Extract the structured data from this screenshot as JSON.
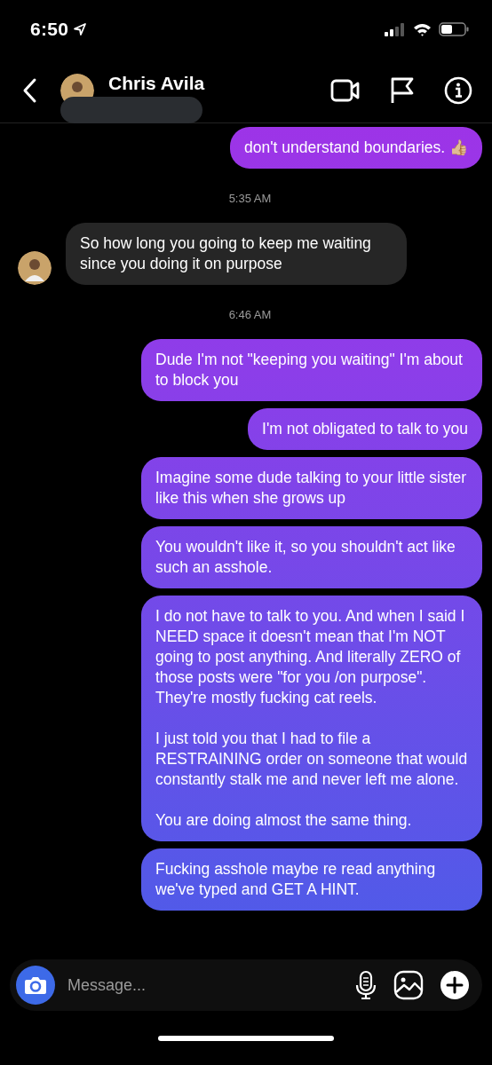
{
  "status_bar": {
    "time": "6:50"
  },
  "header": {
    "name": "Chris Avila"
  },
  "messages": [
    {
      "kind": "outgoing",
      "paragraphs": [
        "don't understand boundaries."
      ],
      "emoji": "👍🏼"
    },
    {
      "kind": "timestamp",
      "text": "5:35 AM"
    },
    {
      "kind": "incoming",
      "paragraphs": [
        "So how long you going to keep me waiting since you doing it on purpose"
      ]
    },
    {
      "kind": "timestamp",
      "text": "6:46 AM"
    },
    {
      "kind": "outgoing",
      "paragraphs": [
        "Dude I'm not \"keeping you waiting\" I'm about to block you"
      ]
    },
    {
      "kind": "outgoing",
      "paragraphs": [
        "I'm not obligated to talk to you"
      ]
    },
    {
      "kind": "outgoing",
      "paragraphs": [
        "Imagine some dude talking to your little sister like this when she grows up"
      ]
    },
    {
      "kind": "outgoing",
      "paragraphs": [
        "You wouldn't like it, so you shouldn't act like such an asshole."
      ]
    },
    {
      "kind": "outgoing",
      "paragraphs": [
        "I do not have to talk to you. And when I said I NEED space it doesn't mean that I'm NOT going to post anything. And literally ZERO of those posts were \"for you /on purpose\". They're mostly fucking cat reels.",
        "I just told you that I had to file a RESTRAINING order on someone that would constantly stalk me and never left me alone.",
        "You are doing almost the same thing."
      ]
    },
    {
      "kind": "outgoing",
      "paragraphs": [
        "Fucking asshole maybe re read anything we've typed and GET A HINT."
      ]
    }
  ],
  "composer": {
    "placeholder": "Message..."
  }
}
